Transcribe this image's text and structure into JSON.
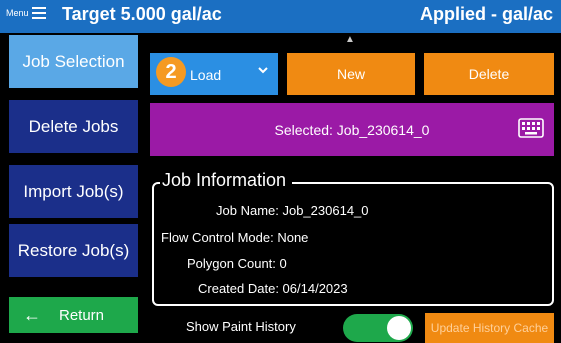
{
  "header": {
    "menu_label": "Menu",
    "title": "Target 5.000 gal/ac",
    "applied": "Applied - gal/ac",
    "background_color": "#1b6fc2"
  },
  "nav": {
    "items": [
      {
        "label": "Job Selection",
        "active": true
      },
      {
        "label": "Delete Jobs",
        "active": false
      },
      {
        "label": "Import Job(s)",
        "active": false
      },
      {
        "label": "Restore Job(s)",
        "active": false
      }
    ],
    "return_label": "Return",
    "return_icon": "arrow-left-icon"
  },
  "toolbar": {
    "badge": "2",
    "load_label": "Load",
    "new_label": "New",
    "delete_label": "Delete",
    "load_color": "#2b8fe3",
    "action_color": "#f08a12"
  },
  "selected": {
    "text": "Selected: Job_230614_0",
    "icon": "keyboard-icon",
    "color": "#9b1aa6"
  },
  "job_info": {
    "title": "Job Information",
    "job_name": "Job Name: Job_230614_0",
    "flow_mode": "Flow Control Mode: None",
    "polygon_count": "Polygon Count: 0",
    "created_date": "Created Date: 06/14/2023"
  },
  "bottom": {
    "paint_history_label": "Show Paint History",
    "toggle_on": true,
    "cache_button_label": "Update History Cache"
  }
}
